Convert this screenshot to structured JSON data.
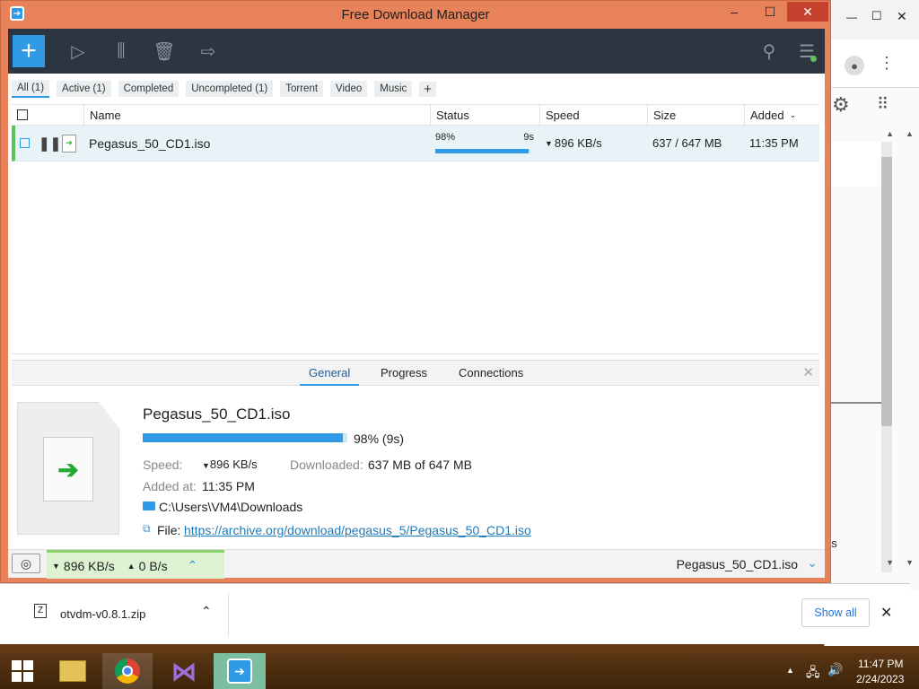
{
  "window": {
    "title": "Free Download Manager",
    "min": "‒",
    "max": "☐",
    "close": "✕"
  },
  "chrome": {
    "min": "—",
    "max": "☐",
    "close": "✕"
  },
  "toolbar": {
    "add": "+"
  },
  "filters": [
    {
      "label": "All (1)"
    },
    {
      "label": "Active (1)"
    },
    {
      "label": "Completed"
    },
    {
      "label": "Uncompleted (1)"
    },
    {
      "label": "Torrent"
    },
    {
      "label": "Video"
    },
    {
      "label": "Music"
    },
    {
      "label": "+"
    }
  ],
  "columns": {
    "name": "Name",
    "status": "Status",
    "speed": "Speed",
    "size": "Size",
    "added": "Added"
  },
  "download": {
    "name": "Pegasus_50_CD1.iso",
    "percent_text": "98%",
    "eta": "9s",
    "progress": 98,
    "speed": "896 KB/s",
    "size": "637 / 647 MB",
    "added": "11:35 PM"
  },
  "details": {
    "tabs": [
      "General",
      "Progress",
      "Connections"
    ],
    "name": "Pegasus_50_CD1.iso",
    "progress_text": "98% (9s)",
    "speed_label": "Speed:",
    "speed": "896 KB/s",
    "downloaded_label": "Downloaded:",
    "downloaded": "637 MB of 647 MB",
    "added_label": "Added at:",
    "added": "11:35 PM",
    "folder": "C:\\Users\\VM4\\Downloads",
    "file_label": "File:",
    "url": "https://archive.org/download/pegasus_5/Pegasus_50_CD1.iso"
  },
  "statusbar": {
    "down": "896 KB/s",
    "up": "0 B/s",
    "current": "Pegasus_50_CD1.iso"
  },
  "shelf": {
    "filename": "otvdm-v0.8.1.zip",
    "show_all": "Show all"
  },
  "side_text": "as",
  "clock": {
    "time": "11:47 PM",
    "date": "2/24/2023"
  },
  "colors": {
    "accent": "#2f9ae6",
    "title": "#e8825a",
    "toolbar": "#2c3540"
  }
}
